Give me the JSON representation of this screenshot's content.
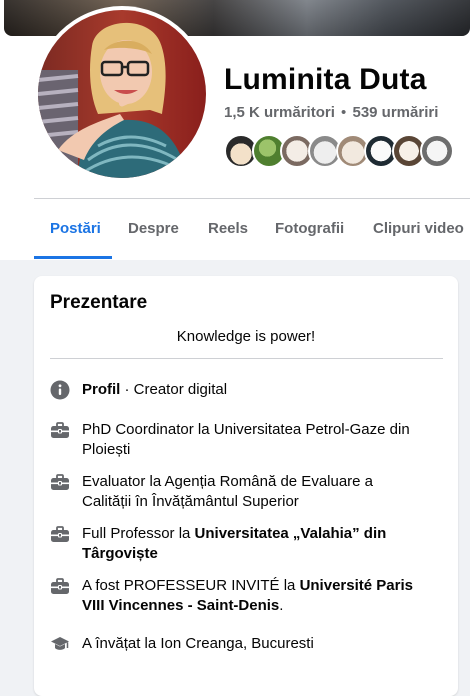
{
  "profile": {
    "name": "Luminita Duta",
    "followers": "1,5 K urmăritori",
    "separator": "•",
    "following": "539 urmăriri",
    "friend_avatars": [
      "friend-1",
      "friend-2",
      "friend-3",
      "friend-4",
      "friend-5",
      "friend-6",
      "friend-7",
      "friend-8"
    ]
  },
  "tabs": [
    {
      "label": "Postări",
      "active": true
    },
    {
      "label": "Despre",
      "active": false
    },
    {
      "label": "Reels",
      "active": false
    },
    {
      "label": "Fotografii",
      "active": false
    },
    {
      "label": "Clipuri video",
      "active": false
    }
  ],
  "intro": {
    "title": "Prezentare",
    "bio": "Knowledge is power!",
    "items": [
      {
        "icon": "info-icon",
        "bold": "Profil",
        "text": " · Creator digital"
      },
      {
        "icon": "briefcase-icon",
        "text": "PhD Coordinator la Universitatea Petrol-Gaze din Ploiești"
      },
      {
        "icon": "briefcase-icon",
        "text": "Evaluator la Agenția Română de Evaluare a Calității în Învățământul Superior"
      },
      {
        "icon": "briefcase-icon",
        "text_before": "Full Professor la ",
        "bold": "Universitatea „Valahia” din Târgoviște"
      },
      {
        "icon": "briefcase-icon",
        "text_before": "A fost PROFESSEUR INVITÉ la ",
        "bold": "Université Paris VIII Vincennes - Saint-Denis",
        "text_after": "."
      },
      {
        "icon": "graduation-cap-icon",
        "text": "A învățat la Ion Creanga, Bucuresti"
      }
    ]
  },
  "colors": {
    "accent": "#1b74e4",
    "secondary_text": "#65676b",
    "icon": "#65676b",
    "background": "#f0f2f5"
  }
}
